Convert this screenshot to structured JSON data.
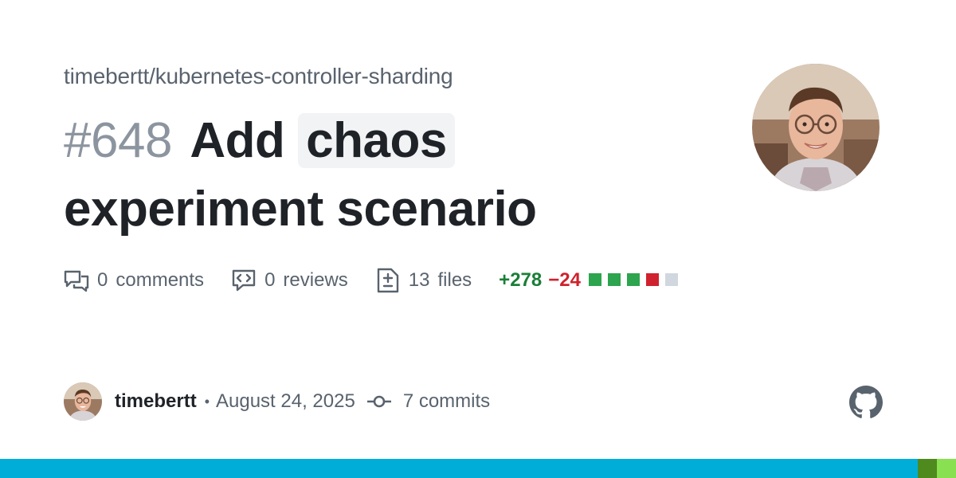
{
  "repo": "timebertt/kubernetes-controller-sharding",
  "pr": {
    "number": "#648",
    "title_before": "Add",
    "title_code": "chaos",
    "title_after": "experiment scenario"
  },
  "stats": {
    "comments_count": "0",
    "comments_label": "comments",
    "reviews_count": "0",
    "reviews_label": "reviews",
    "files_count": "13",
    "files_label": "files",
    "additions": "+278",
    "deletions": "−24",
    "diff_squares": [
      "#2da44e",
      "#2da44e",
      "#2da44e",
      "#cf222e",
      "#d0d7de"
    ]
  },
  "footer": {
    "author": "timebertt",
    "separator": "•",
    "date": "August 24, 2025",
    "commits": "7 commits"
  },
  "colors": {
    "language_bar": [
      "#00add8",
      "#4e8a1d",
      "#89e051"
    ],
    "language_bar_fractions": [
      0.96,
      0.02,
      0.02
    ]
  },
  "icons": [
    "comment-discussion-icon",
    "code-review-icon",
    "file-diff-icon",
    "git-commit-icon",
    "github-mark-icon"
  ]
}
